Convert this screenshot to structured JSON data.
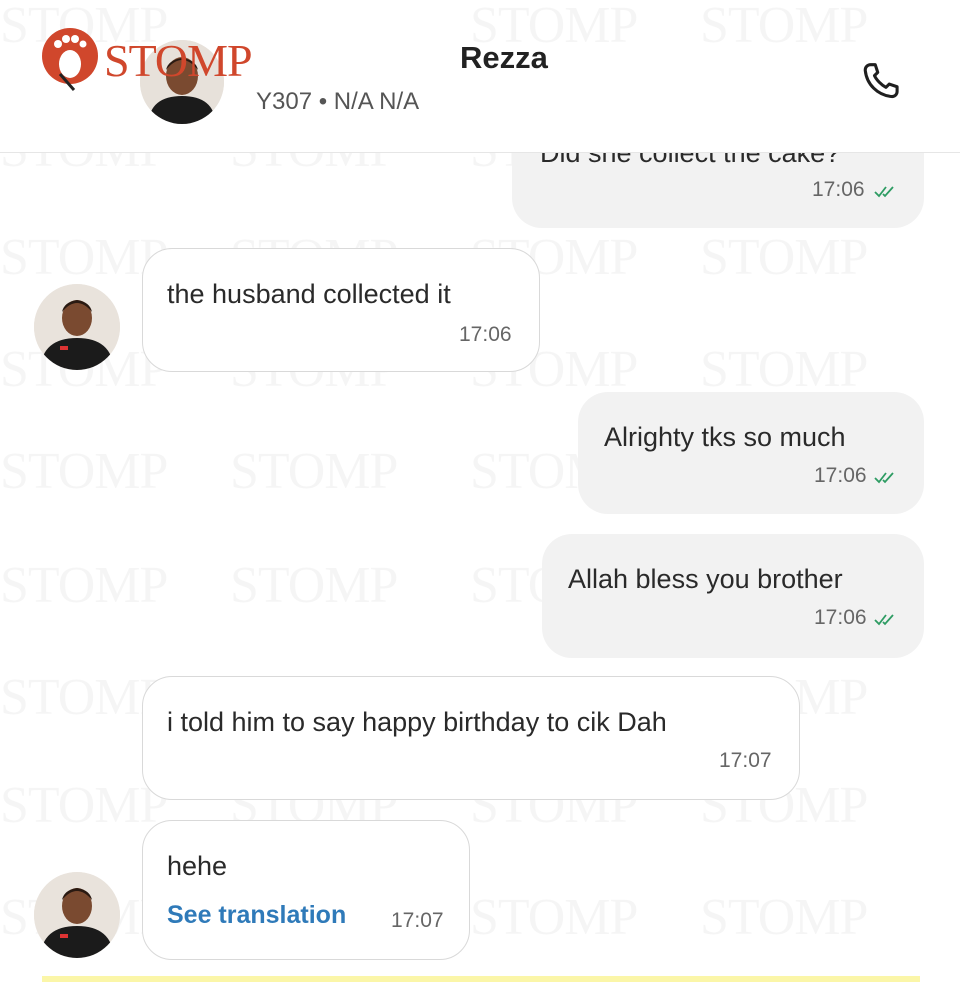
{
  "watermark": {
    "text": "STOMP"
  },
  "header": {
    "logo_text": "STOMP",
    "contact_name": "Rezza",
    "contact_sub": "Y307 • N/A N/A"
  },
  "messages": [
    {
      "direction": "out",
      "text": "Did she collect the cake?",
      "time": "17:06",
      "read": true
    },
    {
      "direction": "in",
      "text": "the husband collected it",
      "time": "17:06"
    },
    {
      "direction": "out",
      "text": "Alrighty tks so much",
      "time": "17:06",
      "read": true
    },
    {
      "direction": "out",
      "text": "Allah bless you brother",
      "time": "17:06",
      "read": true
    },
    {
      "direction": "in",
      "text": "i told him to say happy birthday to cik Dah",
      "time": "17:07"
    },
    {
      "direction": "in",
      "text": "hehe",
      "link": "See translation",
      "time": "17:07"
    }
  ],
  "colors": {
    "tick": "#2e9c63",
    "link": "#2f7ab9",
    "brand": "#d0472c"
  }
}
